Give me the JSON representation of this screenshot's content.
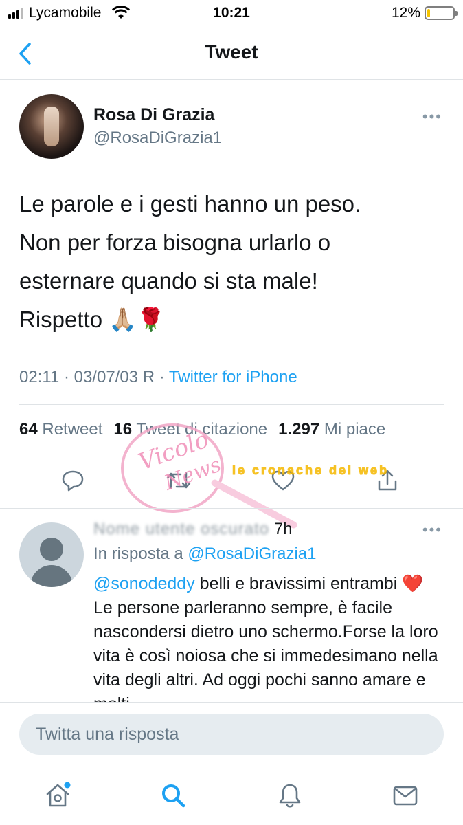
{
  "status_bar": {
    "carrier": "Lycamobile",
    "time": "10:21",
    "battery_percent": "12%",
    "battery_level": 0.12,
    "battery_color": "#f5c400"
  },
  "nav": {
    "back_icon": "chevron-left-icon",
    "title": "Tweet"
  },
  "tweet": {
    "author_name": "Rosa Di Grazia",
    "author_handle": "@RosaDiGrazia1",
    "lines": [
      "Le parole e i gesti hanno un peso.",
      "Non per forza bisogna urlarlo o",
      "esternare quando si sta male!",
      "Rispetto 🙏🏼🌹"
    ],
    "timestamp": "02:11 · 03/07/03 R ·",
    "source": "Twitter for iPhone",
    "stats": {
      "retweets_count": "64",
      "retweets_label": "Retweet",
      "quotes_count": "16",
      "quotes_label": "Tweet di citazione",
      "likes_count": "1.297",
      "likes_label": "Mi piace"
    },
    "actions": [
      "reply-icon",
      "retweet-icon",
      "like-icon",
      "share-icon"
    ]
  },
  "watermark": {
    "line1": "Vicolo",
    "line2": "News",
    "banner": "le cronache del web"
  },
  "reply": {
    "header_name_blurred": "Nome utente oscurato",
    "time": "7h",
    "in_reply_prefix": "In risposta a",
    "in_reply_handle": "@RosaDiGrazia1",
    "mention": "@sonodeddy",
    "text_part1": " belli e bravissimi entrambi",
    "heart": "❤️",
    "text_part2": " Le persone parleranno sempre, è facile nascondersi dietro uno schermo.Forse la loro vita è così noiosa che si immedesimano nella vita degli altri. Ad oggi pochi sanno amare e molti"
  },
  "compose": {
    "placeholder": "Twitta una risposta"
  },
  "tab_bar": {
    "tabs": [
      "home-icon",
      "search-icon",
      "notifications-icon",
      "messages-icon"
    ],
    "accent": "#1da1f2"
  }
}
